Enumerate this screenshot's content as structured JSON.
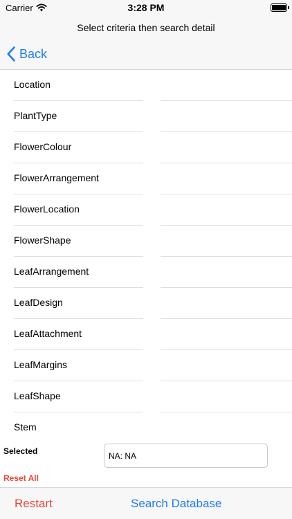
{
  "status_bar": {
    "carrier": "Carrier",
    "time": "3:28 PM",
    "wifi_icon": "wifi-icon",
    "battery_icon": "battery-icon"
  },
  "nav": {
    "title": "Select criteria then search detail",
    "back_label": "Back",
    "back_icon": "chevron-left-icon"
  },
  "criteria": [
    {
      "label": "Location"
    },
    {
      "label": "PlantType"
    },
    {
      "label": "FlowerColour"
    },
    {
      "label": "FlowerArrangement"
    },
    {
      "label": "FlowerLocation"
    },
    {
      "label": "FlowerShape"
    },
    {
      "label": "LeafArrangement"
    },
    {
      "label": "LeafDesign"
    },
    {
      "label": "LeafAttachment"
    },
    {
      "label": "LeafMargins"
    },
    {
      "label": "LeafShape"
    },
    {
      "label": "Stem"
    }
  ],
  "selected": {
    "label": "Selected",
    "value": "NA: NA"
  },
  "reset_all": "Reset All",
  "toolbar": {
    "restart_label": "Restart",
    "search_label": "Search Database"
  },
  "colors": {
    "accent_blue": "#1e7cf2",
    "destructive_red": "#e8473c",
    "bar_background": "#f7f7f7"
  }
}
